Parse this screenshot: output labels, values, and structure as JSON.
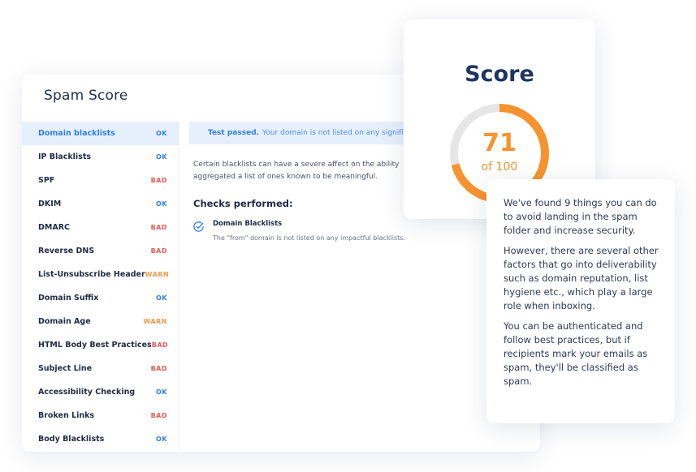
{
  "spam_score": {
    "title": "Spam Score",
    "items": [
      {
        "label": "Domain blacklists",
        "status": "OK",
        "status_color": "#2f80ed",
        "active": true
      },
      {
        "label": "IP Blacklists",
        "status": "OK",
        "status_color": "#2f80ed"
      },
      {
        "label": "SPF",
        "status": "BAD",
        "status_color": "#eb5757"
      },
      {
        "label": "DKIM",
        "status": "OK",
        "status_color": "#2f80ed"
      },
      {
        "label": "DMARC",
        "status": "BAD",
        "status_color": "#eb5757"
      },
      {
        "label": "Reverse DNS",
        "status": "BAD",
        "status_color": "#eb5757"
      },
      {
        "label": "List-Unsubscribe Header",
        "status": "WARN",
        "status_color": "#f2994a"
      },
      {
        "label": "Domain Suffix",
        "status": "OK",
        "status_color": "#2f80ed"
      },
      {
        "label": "Domain Age",
        "status": "WARN",
        "status_color": "#f2994a"
      },
      {
        "label": "HTML Body Best Practices",
        "status": "BAD",
        "status_color": "#eb5757"
      },
      {
        "label": "Subject Line",
        "status": "BAD",
        "status_color": "#eb5757"
      },
      {
        "label": "Accessibility Checking",
        "status": "OK",
        "status_color": "#2f80ed"
      },
      {
        "label": "Broken Links",
        "status": "BAD",
        "status_color": "#eb5757"
      },
      {
        "label": "Body Blacklists",
        "status": "OK",
        "status_color": "#2f80ed"
      }
    ]
  },
  "detail": {
    "banner_strong": "Test passed.",
    "banner_text": "Your domain is not listed on any significant",
    "description": "Certain blacklists can have a severe affect on the ability aggregated a list of ones known to be meaningful.",
    "checks_heading": "Checks performed:",
    "check_title": "Domain Blacklists",
    "check_desc": "The \"from\" domain is not listed on any impactful blacklists.",
    "check_icon": "check-circle-icon"
  },
  "score": {
    "title": "Score",
    "value": "71",
    "of_label": "of 100",
    "fraction": 0.71,
    "accent": "#f7932f",
    "track": "#e6e6e6"
  },
  "info": {
    "paragraphs": [
      "We've found 9 things you can do to avoid landing in the spam folder and increase security.",
      "However, there are several other factors that go into deliverability such as domain reputation, list hygiene etc., which play a large role when inboxing.",
      "You can be authenticated and follow best practices, but if recipients mark your emails as spam, they'll be classified as spam."
    ]
  }
}
